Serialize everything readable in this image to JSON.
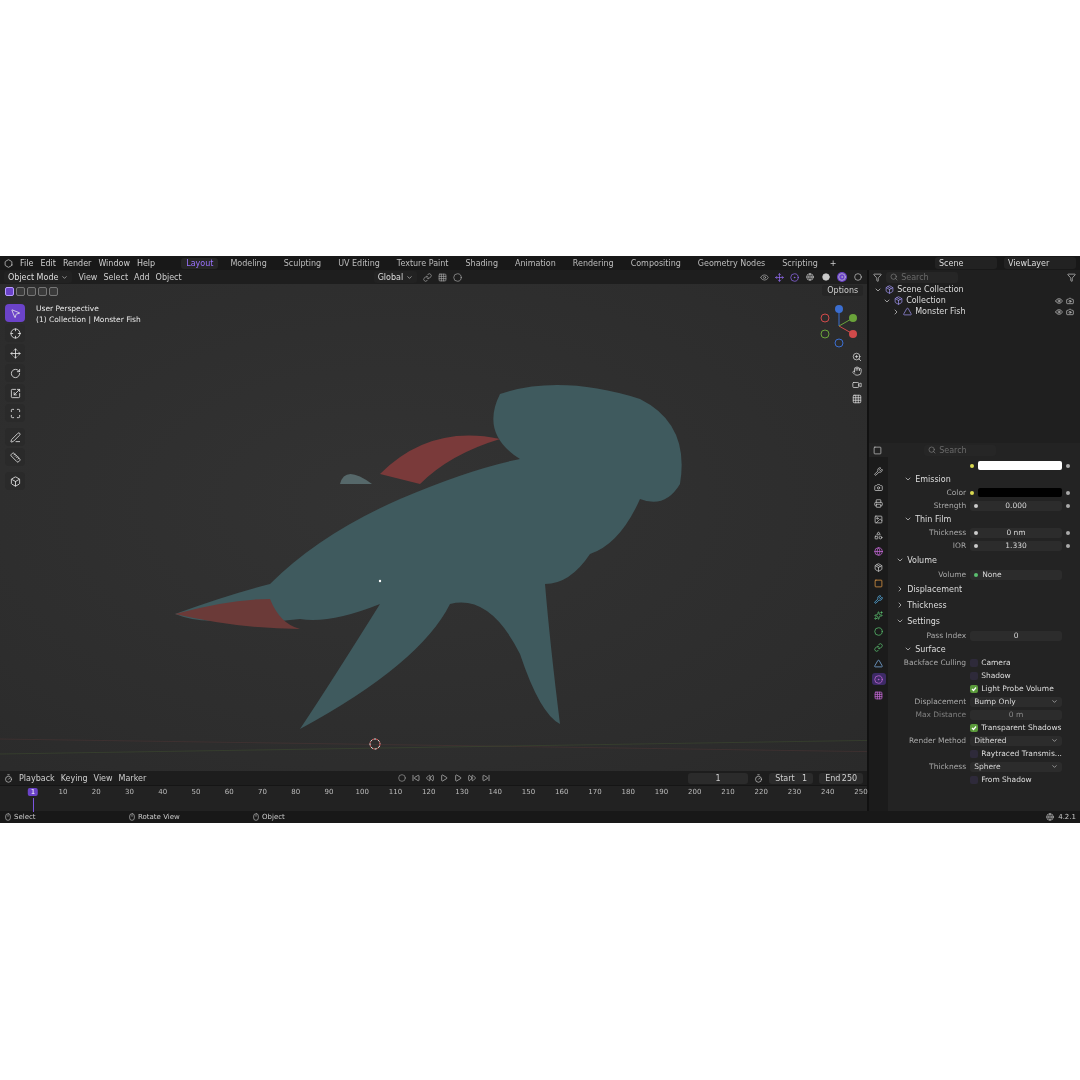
{
  "menu": [
    "File",
    "Edit",
    "Render",
    "Window",
    "Help"
  ],
  "workspace_tabs": [
    {
      "label": "Layout",
      "selected": true
    },
    {
      "label": "Modeling",
      "selected": false
    },
    {
      "label": "Sculpting",
      "selected": false
    },
    {
      "label": "UV Editing",
      "selected": false
    },
    {
      "label": "Texture Paint",
      "selected": false
    },
    {
      "label": "Shading",
      "selected": false
    },
    {
      "label": "Animation",
      "selected": false
    },
    {
      "label": "Rendering",
      "selected": false
    },
    {
      "label": "Compositing",
      "selected": false
    },
    {
      "label": "Geometry Nodes",
      "selected": false
    },
    {
      "label": "Scripting",
      "selected": false
    }
  ],
  "add_tab": "+",
  "scene": "Scene",
  "view_layer": "ViewLayer",
  "viewport_header": {
    "mode": "Object Mode",
    "menus": [
      "View",
      "Select",
      "Add",
      "Object"
    ],
    "transform": "Global",
    "shading_modes": [
      {
        "kind": "wireframe",
        "selected": false
      },
      {
        "kind": "solid",
        "selected": false
      },
      {
        "kind": "material",
        "selected": true
      },
      {
        "kind": "rendered",
        "selected": false
      }
    ]
  },
  "viewport": {
    "options": "Options",
    "perspective": "User Perspective",
    "context": "(1) Collection | Monster Fish",
    "select_modes": [
      {
        "selected": true
      },
      {
        "selected": false
      },
      {
        "selected": false
      },
      {
        "selected": false
      },
      {
        "selected": false
      }
    ],
    "tools": [
      {
        "kind": "select",
        "selected": true
      },
      {
        "kind": "cursor",
        "selected": false
      },
      {
        "kind": "move",
        "selected": false
      },
      {
        "kind": "rotate",
        "selected": false
      },
      {
        "kind": "scale",
        "selected": false
      },
      {
        "kind": "transform",
        "selected": false
      },
      {
        "kind": "annotate",
        "selected": false
      },
      {
        "kind": "measure",
        "selected": false
      },
      {
        "kind": "add",
        "selected": false
      }
    ]
  },
  "outliner": {
    "search_placeholder": "Search",
    "tree": [
      {
        "label": "Scene Collection",
        "expanded": true,
        "children": [
          {
            "label": "Collection",
            "expanded": true,
            "children": [
              {
                "label": "Monster Fish",
                "expanded": false
              }
            ]
          }
        ]
      }
    ]
  },
  "properties": {
    "search_placeholder": "Search",
    "tabs": [
      {
        "kind": "tool",
        "selected": false
      },
      {
        "kind": "render",
        "selected": false
      },
      {
        "kind": "output",
        "selected": false
      },
      {
        "kind": "view",
        "selected": false
      },
      {
        "kind": "scene",
        "selected": false
      },
      {
        "kind": "world",
        "selected": false
      },
      {
        "kind": "collection",
        "selected": false
      },
      {
        "kind": "object",
        "selected": false
      },
      {
        "kind": "modifier",
        "selected": false
      },
      {
        "kind": "particles",
        "selected": false
      },
      {
        "kind": "physics",
        "selected": false
      },
      {
        "kind": "constraints",
        "selected": false
      },
      {
        "kind": "data",
        "selected": false
      },
      {
        "kind": "material",
        "selected": true
      },
      {
        "kind": "texture",
        "selected": false
      }
    ],
    "rows": [
      {
        "kind": "color",
        "color": "#ffffff"
      },
      {
        "kind": "subpanel",
        "label": "Emission",
        "expanded": true
      },
      {
        "kind": "color",
        "label": "Color",
        "color": "#000000"
      },
      {
        "kind": "number",
        "label": "Strength",
        "value": "0.000"
      },
      {
        "kind": "subpanel",
        "label": "Thin Film",
        "expanded": true
      },
      {
        "kind": "number",
        "label": "Thickness",
        "value": "0 nm"
      },
      {
        "kind": "number",
        "label": "IOR",
        "value": "1.330"
      },
      {
        "kind": "panel",
        "label": "Volume",
        "expanded": true
      },
      {
        "kind": "link",
        "label": "Volume",
        "value": "None"
      },
      {
        "kind": "panel",
        "label": "Displacement",
        "expanded": false
      },
      {
        "kind": "panel",
        "label": "Thickness",
        "expanded": false
      },
      {
        "kind": "panel",
        "label": "Settings",
        "expanded": true
      },
      {
        "kind": "field",
        "label": "Pass Index",
        "value": "0",
        "disabled": false
      },
      {
        "kind": "subpanel",
        "label": "Surface",
        "expanded": true
      },
      {
        "kind": "checkbox",
        "label": "Backface Culling",
        "text": "Camera",
        "checked": false
      },
      {
        "kind": "checkbox",
        "text": "Shadow",
        "checked": false
      },
      {
        "kind": "checkbox",
        "text": "Light Probe Volume",
        "checked": true
      },
      {
        "kind": "dropdown",
        "label": "Displacement",
        "value": "Bump Only"
      },
      {
        "kind": "field",
        "label": "Max Distance",
        "value": "0 m",
        "disabled": true
      },
      {
        "kind": "checkbox",
        "text": "Transparent Shadows",
        "checked": true
      },
      {
        "kind": "dropdown",
        "label": "Render Method",
        "value": "Dithered"
      },
      {
        "kind": "checkbox",
        "text": "Raytraced Transmis...",
        "checked": false
      },
      {
        "kind": "dropdown",
        "label": "Thickness",
        "value": "Sphere"
      },
      {
        "kind": "checkbox",
        "text": "From Shadow",
        "checked": false
      }
    ]
  },
  "timeline": {
    "menus": [
      "Playback",
      "Keying",
      "View",
      "Marker"
    ],
    "current_frame": "1",
    "start_label": "Start",
    "start": "1",
    "end_label": "End",
    "end": "250",
    "ticks": [
      {
        "label": "1",
        "selected": true
      },
      {
        "label": "10",
        "selected": false
      },
      {
        "label": "20",
        "selected": false
      },
      {
        "label": "30",
        "selected": false
      },
      {
        "label": "40",
        "selected": false
      },
      {
        "label": "50",
        "selected": false
      },
      {
        "label": "60",
        "selected": false
      },
      {
        "label": "70",
        "selected": false
      },
      {
        "label": "80",
        "selected": false
      },
      {
        "label": "90",
        "selected": false
      },
      {
        "label": "100",
        "selected": false
      },
      {
        "label": "110",
        "selected": false
      },
      {
        "label": "120",
        "selected": false
      },
      {
        "label": "130",
        "selected": false
      },
      {
        "label": "140",
        "selected": false
      },
      {
        "label": "150",
        "selected": false
      },
      {
        "label": "160",
        "selected": false
      },
      {
        "label": "170",
        "selected": false
      },
      {
        "label": "180",
        "selected": false
      },
      {
        "label": "190",
        "selected": false
      },
      {
        "label": "200",
        "selected": false
      },
      {
        "label": "210",
        "selected": false
      },
      {
        "label": "220",
        "selected": false
      },
      {
        "label": "230",
        "selected": false
      },
      {
        "label": "240",
        "selected": false
      },
      {
        "label": "250",
        "selected": false
      }
    ]
  },
  "status_bar": {
    "hints": [
      "Select",
      "Rotate View",
      "Object"
    ],
    "version": "4.2.1"
  }
}
